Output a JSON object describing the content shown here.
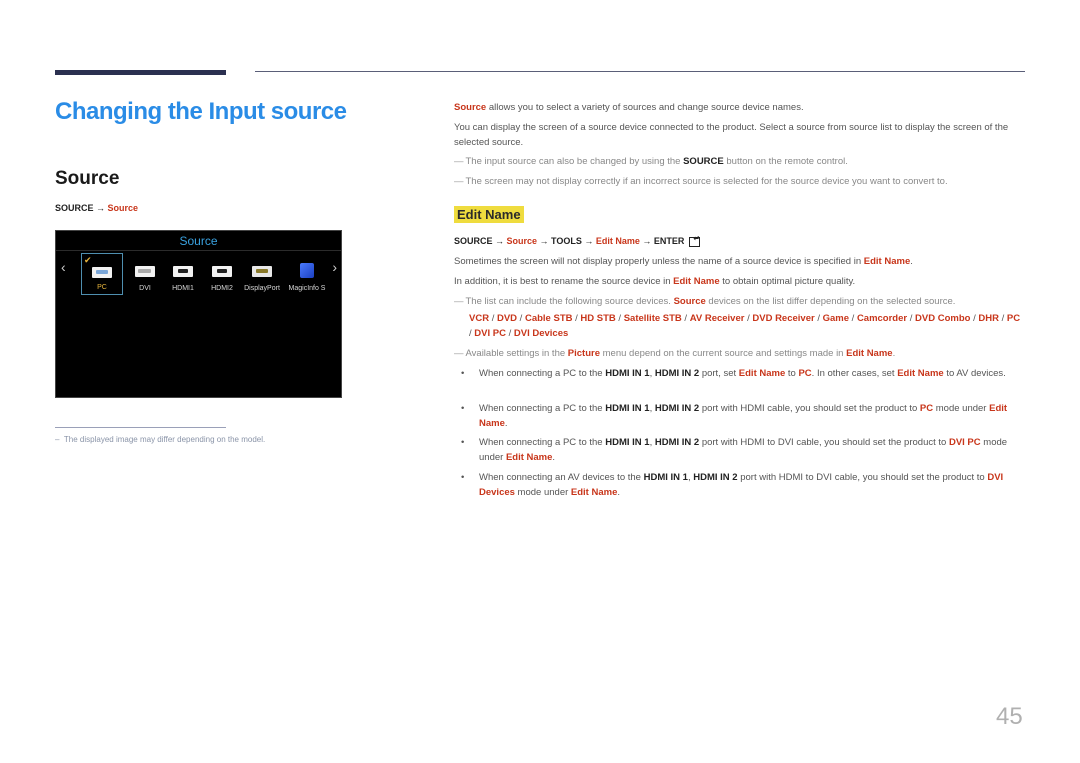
{
  "page": {
    "title": "Changing the Input source",
    "section_title": "Source",
    "page_number": "45"
  },
  "left": {
    "path": {
      "prefix": "SOURCE → ",
      "target": "Source"
    },
    "osd": {
      "title": "Source",
      "items": [
        {
          "label": "PC",
          "icon": "vga-port-icon",
          "selected": true
        },
        {
          "label": "DVI",
          "icon": "dvi-port-icon",
          "selected": false
        },
        {
          "label": "HDMI1",
          "icon": "hdmi-port-icon",
          "selected": false
        },
        {
          "label": "HDMI2",
          "icon": "hdmi-port-icon",
          "selected": false
        },
        {
          "label": "DisplayPort",
          "icon": "displayport-icon",
          "selected": false
        },
        {
          "label": "MagicInfo S",
          "icon": "magicinfo-cube-icon",
          "selected": false
        }
      ],
      "prev_arrow": "‹",
      "next_arrow": "›",
      "check": "✔"
    },
    "footnote": "The displayed image may differ depending on the model.",
    "footnote_dash": "–"
  },
  "right": {
    "intro": {
      "highlight": "Source",
      "text": " allows you to select a variety of sources and change source device names."
    },
    "para2": "You can display the screen of a source device connected to the product. Select a source from source list to display the screen of the selected source.",
    "note1": {
      "pre": "The input source can also be changed by using the ",
      "bold": "SOURCE",
      "post": " button on the remote control."
    },
    "note2": "The screen may not display correctly if an incorrect source is selected for the source device you want to convert to.",
    "dash": "—",
    "edit_name": {
      "heading": "Edit Name",
      "path": {
        "p1": "SOURCE → ",
        "r1": "Source",
        "p2": " → TOOLS → ",
        "r2": "Edit Name",
        "p3": " → ENTER"
      },
      "para1": {
        "pre": "Sometimes the screen will not display properly unless the name of a source device is specified in ",
        "red": "Edit Name",
        "post": "."
      },
      "para2": {
        "pre": "In addition, it is best to rename the source device in ",
        "red": "Edit Name",
        "post": " to obtain optimal picture quality."
      },
      "note_list": {
        "pre": "The list can include the following source devices. ",
        "red": "Source",
        "post": " devices on the list differ depending on the selected source."
      },
      "devices": [
        "VCR",
        "DVD",
        "Cable STB",
        "HD STB",
        "Satellite STB",
        "AV Receiver",
        "DVD Receiver",
        "Game",
        "Camcorder",
        "DVD Combo",
        "DHR",
        "PC",
        "DVI PC",
        "DVI Devices"
      ],
      "device_sep": " / ",
      "note_picture": {
        "pre": "Available settings in the ",
        "red1": "Picture",
        "mid": " menu depend on the current source and settings made in ",
        "red2": "Edit Name",
        "post": "."
      },
      "bullets": [
        {
          "t1": "When connecting a PC to the ",
          "b1": "HDMI IN 1",
          "t2": ", ",
          "b2": "HDMI IN 2",
          "t3": " port, set ",
          "r1": "Edit Name",
          "t4": " to ",
          "r2": "PC",
          "t5": ". In other cases, set ",
          "r3": "Edit Name",
          "t6": " to AV devices."
        },
        {
          "t1": "When connecting a PC to the ",
          "b1": "HDMI IN 1",
          "t2": ", ",
          "b2": "HDMI IN 2",
          "t3": " port with HDMI cable, you should set the product to ",
          "r1": "PC",
          "t4": " mode under ",
          "r2": "Edit Name",
          "t5": "."
        },
        {
          "t1": "When connecting a PC to the ",
          "b1": "HDMI IN 1",
          "t2": ", ",
          "b2": "HDMI IN 2",
          "t3": " port with HDMI to DVI cable, you should set the product to ",
          "r1": "DVI PC",
          "t4": " mode under ",
          "r2": "Edit Name",
          "t5": "."
        },
        {
          "t1": "When connecting an AV devices to the ",
          "b1": "HDMI IN 1",
          "t2": ", ",
          "b2": "HDMI IN 2",
          "t3": " port with HDMI to DVI cable, you should set the product to ",
          "r1": "DVI Devices",
          "t4": " mode under ",
          "r2": "Edit Name",
          "t5": "."
        }
      ],
      "bullet_glyph": "•"
    }
  }
}
